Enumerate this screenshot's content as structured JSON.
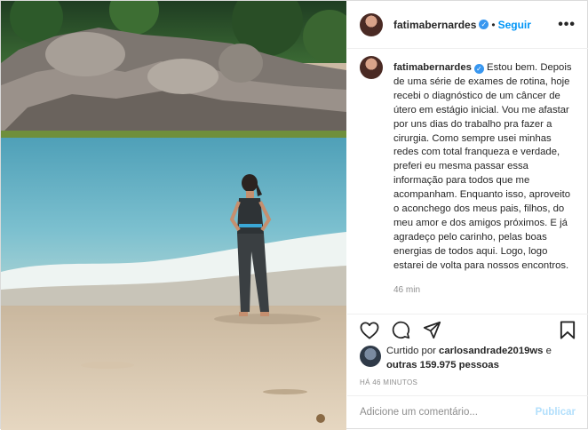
{
  "post": {
    "author": "fatimabernardes",
    "follow_label": "Seguir",
    "separator": "•",
    "verified_glyph": "✓",
    "more_glyph": "•••",
    "caption": "Estou bem. Depois de uma série de exames de rotina, hoje recebi o diagnóstico de um câncer de útero em estágio inicial. Vou me afastar por uns dias do trabalho pra fazer a cirurgia. Como sempre usei minhas redes com total franqueza e verdade, preferi eu mesma passar essa informação para todos que me acompanham. Enquanto isso, aproveito o aconchego dos meus pais, filhos, do meu amor e dos amigos próximos. E já agradeço pelo carinho, pelas boas energias de todos aqui. Logo, logo estarei de volta para nossos encontros.",
    "caption_time": "46 min",
    "liked_prefix": "Curtido por",
    "liked_by": "carlosandrade2019ws",
    "liked_and": "e",
    "liked_others": "outras 159.975 pessoas",
    "age": "HÁ 46 MINUTOS",
    "comment_placeholder": "Adicione um comentário...",
    "publish_label": "Publicar"
  },
  "icons": {
    "like": "heart-icon",
    "comment": "comment-icon",
    "share": "share-icon",
    "save": "bookmark-icon"
  },
  "colors": {
    "accent": "#0095f6",
    "publish_disabled": "#b2dffc",
    "verified": "#3897f0"
  }
}
